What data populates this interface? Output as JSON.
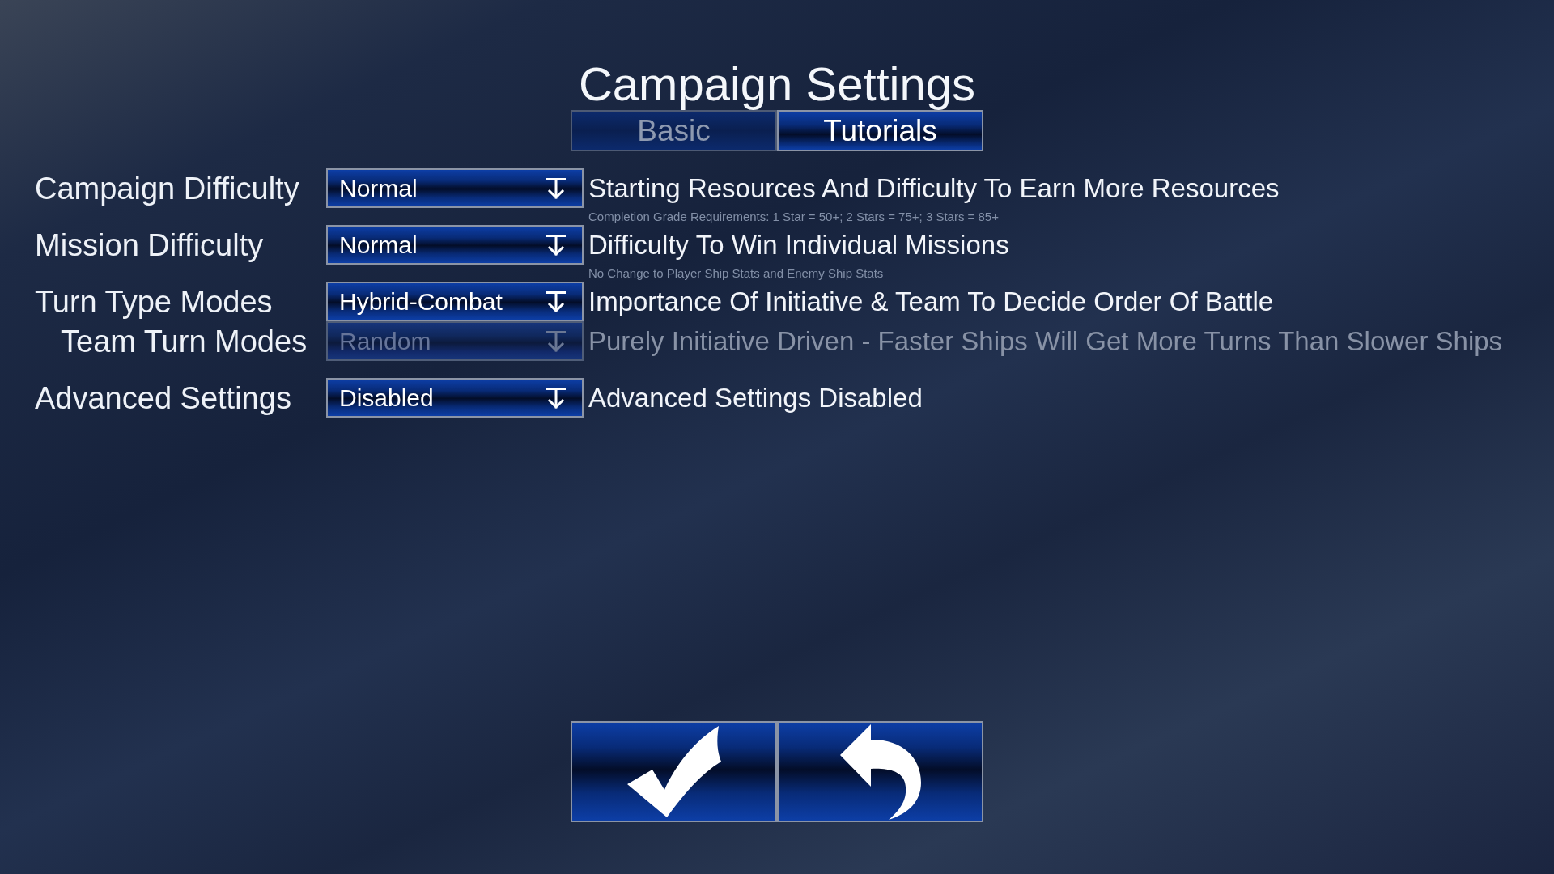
{
  "title": "Campaign Settings",
  "tabs": [
    {
      "label": "Basic",
      "selected": false
    },
    {
      "label": "Tutorials",
      "selected": true
    }
  ],
  "settings": [
    {
      "label": "Campaign Difficulty",
      "value": "Normal",
      "disabled": false,
      "description": "Starting Resources And Difficulty To Earn More Resources",
      "note": "Completion Grade Requirements: 1 Star = 50+; 2 Stars = 75+; 3 Stars = 85+"
    },
    {
      "label": "Mission Difficulty",
      "value": "Normal",
      "disabled": false,
      "description": "Difficulty To Win Individual Missions",
      "note": "No Change to Player Ship Stats and Enemy Ship Stats"
    },
    {
      "label": "Turn Type Modes",
      "value": "Hybrid-Combat",
      "disabled": false,
      "description": "Importance Of Initiative & Team To Decide Order Of Battle",
      "children": [
        {
          "label": "Team Turn Modes",
          "value": "Random",
          "disabled": true,
          "description": "Purely Initiative Driven - Faster Ships Will Get More Turns Than Slower Ships"
        }
      ]
    },
    {
      "label": "Advanced Settings",
      "value": "Disabled",
      "disabled": false,
      "description": "Advanced Settings Disabled"
    }
  ],
  "buttons": [
    {
      "kind": "confirm"
    },
    {
      "kind": "back"
    }
  ]
}
